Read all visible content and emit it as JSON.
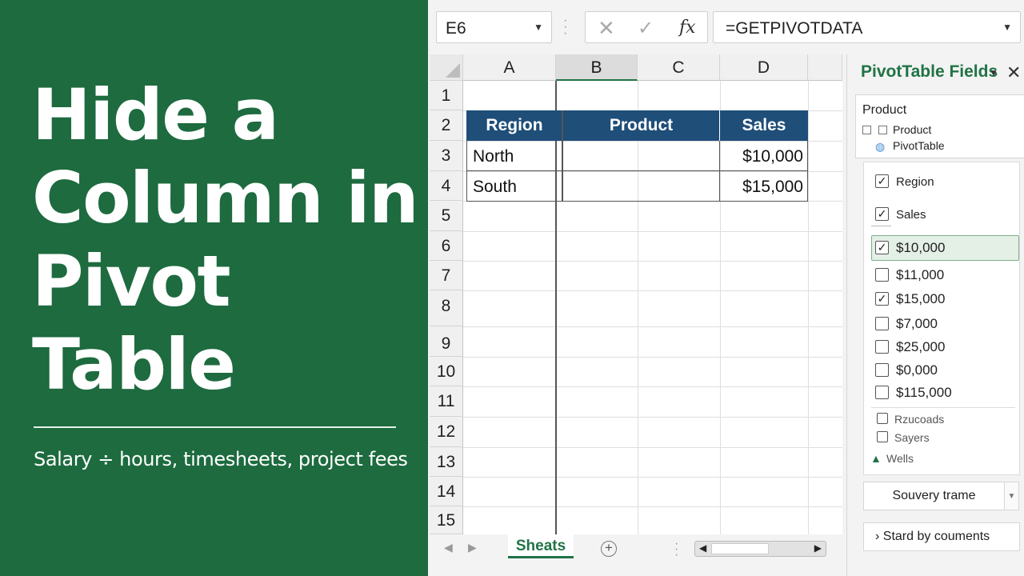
{
  "banner": {
    "title_lines": [
      "Hide a",
      "Column in",
      "Pivot",
      "Table"
    ],
    "subtitle": "Salary ÷ hours, timesheets, project fees"
  },
  "formula_bar": {
    "name_box": "E6",
    "cancel_icon": "✕",
    "enter_icon": "✓",
    "fx_label": "fx",
    "formula": "=GETPIVOTDATA"
  },
  "grid": {
    "columns": [
      "A",
      "B",
      "C",
      "D"
    ],
    "selected_column": "B",
    "rows": [
      "1",
      "2",
      "3",
      "4",
      "5",
      "6",
      "7",
      "8",
      "9",
      "10",
      "11",
      "12",
      "13",
      "14",
      "15"
    ]
  },
  "pivot": {
    "headers": [
      "Region",
      "Product",
      "Sales"
    ],
    "rows": [
      {
        "region": "North",
        "product": "",
        "sales": "$10,000"
      },
      {
        "region": "South",
        "product": "",
        "sales": "$15,000"
      }
    ],
    "header_color": "#1f4e79"
  },
  "sheets": {
    "active_tab": "Sheats",
    "add_symbol": "+"
  },
  "pane": {
    "title": "PivotTable Fields",
    "search_label": "Product",
    "mini_items": [
      "Product",
      "PivotTable"
    ],
    "fields": [
      {
        "label": "Region",
        "checked": true
      },
      {
        "label": "Sales",
        "checked": true
      }
    ],
    "values": [
      {
        "label": "$10,000",
        "checked": true,
        "selected": true
      },
      {
        "label": "$11,000",
        "checked": false
      },
      {
        "label": "$15,000",
        "checked": true
      },
      {
        "label": "$7,000",
        "checked": false
      },
      {
        "label": "$25,000",
        "checked": false
      },
      {
        "label": "$0,000",
        "checked": false
      },
      {
        "label": "$115,000",
        "checked": false
      }
    ],
    "extra_fields": [
      "Rzucoads",
      "Sayers"
    ],
    "section_label": "Wells",
    "summary_button": "Souvery trame",
    "defer_button": "Stard by couments"
  },
  "colors": {
    "brand_green": "#1d6b3f",
    "excel_green": "#217346"
  }
}
